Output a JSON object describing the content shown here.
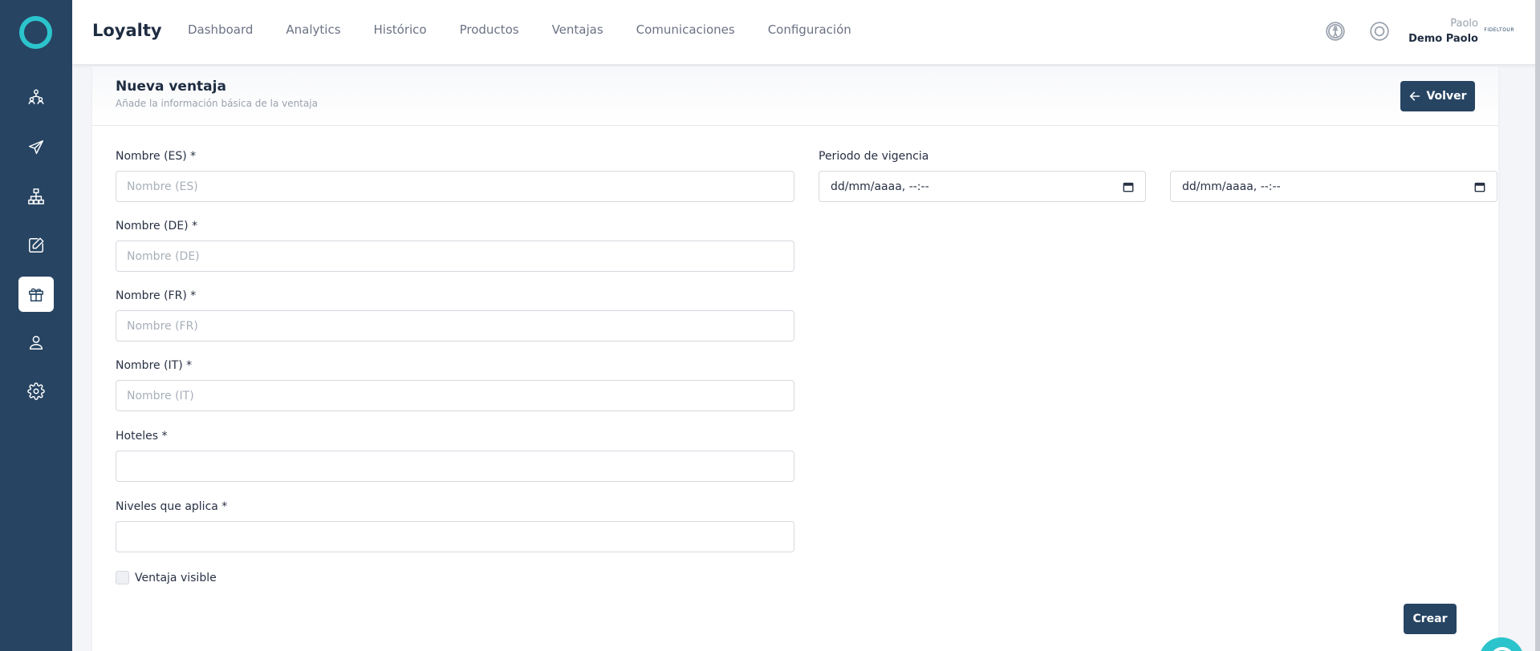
{
  "app": {
    "brand": "Loyalty"
  },
  "nav": [
    "Dashboard",
    "Analytics",
    "Histórico",
    "Productos",
    "Ventajas",
    "Comunicaciones",
    "Configuración"
  ],
  "user": {
    "name": "Paolo",
    "company": "Demo Paolo",
    "logo_text": "FIDELTOUR"
  },
  "sidebar": {
    "items": [
      {
        "icon": "users-hierarchy-icon"
      },
      {
        "icon": "send-icon"
      },
      {
        "icon": "sitemap-icon"
      },
      {
        "icon": "edit-icon"
      },
      {
        "icon": "gift-icon",
        "active": true
      },
      {
        "icon": "user-icon"
      },
      {
        "icon": "gear-icon"
      }
    ]
  },
  "form": {
    "title": "Nueva ventaja",
    "subtitle": "Añade la información básica de la ventaja",
    "back_label": "Volver",
    "fields": {
      "name_es": {
        "label": "Nombre (ES) *",
        "placeholder": "Nombre (ES)"
      },
      "name_de": {
        "label": "Nombre (DE) *",
        "placeholder": "Nombre (DE)"
      },
      "name_fr": {
        "label": "Nombre (FR) *",
        "placeholder": "Nombre (FR)"
      },
      "name_it": {
        "label": "Nombre (IT) *",
        "placeholder": "Nombre (IT)"
      },
      "hotels": {
        "label": "Hoteles *"
      },
      "levels": {
        "label": "Niveles que aplica *"
      }
    },
    "validity": {
      "label": "Periodo de vigencia",
      "start": "dd/mm/aaaa, --:--",
      "end": "dd/mm/aaaa, --:--"
    },
    "visible": {
      "label": "Ventaja visible",
      "checked": false
    },
    "create_label": "Crear"
  },
  "colors": {
    "sidebar": "#274462",
    "accent": "#2cc4cc",
    "primary_button": "#274462"
  }
}
